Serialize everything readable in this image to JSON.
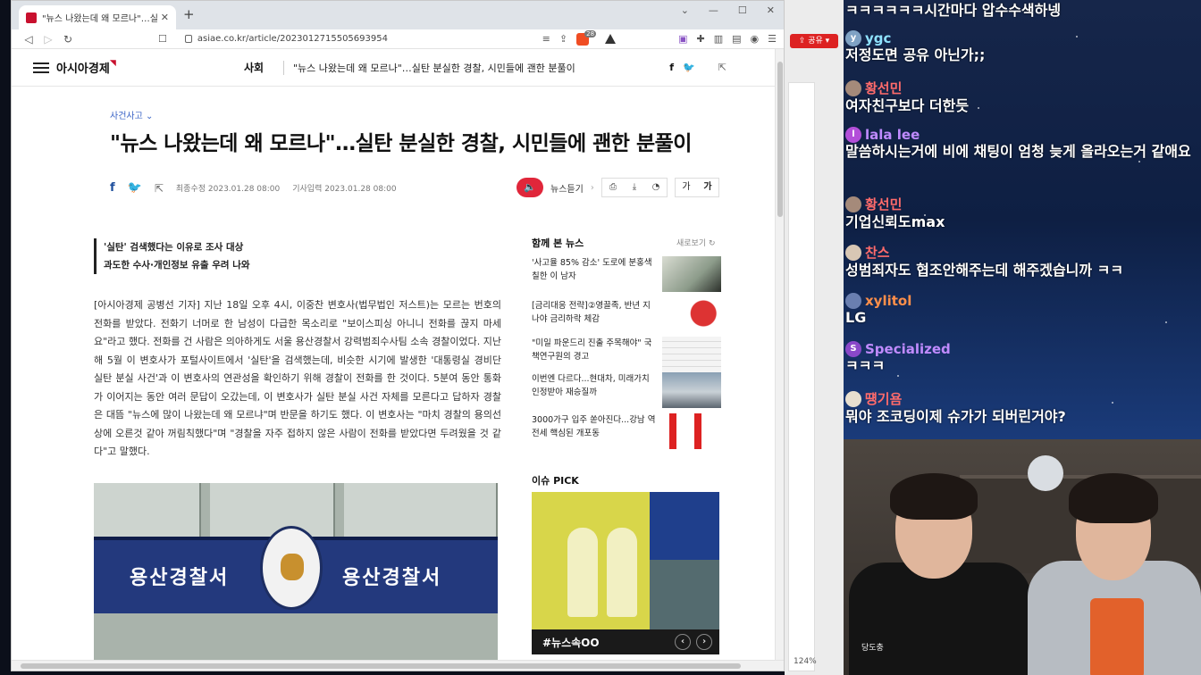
{
  "browser": {
    "tab_title": "\"뉴스 나왔는데 왜 모르나\"…실탄",
    "new_tab_icon": "plus-icon",
    "url": "asiae.co.kr/article/2023012715505693954",
    "brave_count": "28"
  },
  "site": {
    "logo": "아시아경제",
    "section": "사회",
    "header_headline": "\"뉴스 나왔는데 왜 모르나\"…실탄 분실한 경찰, 시민들에 괜한 분풀이"
  },
  "article": {
    "category": "사건사고",
    "title": "\"뉴스 나왔는데 왜 모르나\"…실탄 분실한 경찰, 시민들에 괜한 분풀이",
    "updated_label": "최종수정",
    "updated": "2023.01.28 08:00",
    "published_label": "기사입력",
    "published": "2023.01.28 08:00",
    "listen_label": "뉴스듣기",
    "font_small": "가",
    "font_large": "가",
    "subtitle_1": "'실탄' 검색했다는 이유로 조사 대상",
    "subtitle_2": "과도한 수사·개인정보 유출 우려 나와",
    "body": "[아시아경제 공병선 기자] 지난 18일 오후 4시, 이중찬 변호사(법무법인 저스트)는 모르는 번호의 전화를 받았다. 전화기 너머로 한 남성이 다급한 목소리로 \"보이스피싱 아니니 전화를 끊지 마세요\"라고 했다. 전화를 건 사람은 의아하게도 서울 용산경찰서 강력범죄수사팀 소속 경찰이었다. 지난해 5월 이 변호사가 포털사이트에서 '실탄'을 검색했는데, 비슷한 시기에 발생한 '대통령실 경비단 실탄 분실 사건'과 이 변호사의 연관성을 확인하기 위해 경찰이 전화를 한 것이다. 5분여 동안 통화가 이어지는 동안 여러 문답이 오갔는데, 이 변호사가 실탄 분실 사건 자체를 모른다고 답하자 경찰은 대뜸 \"뉴스에 많이 나왔는데 왜 모르냐\"며 반문을 하기도 했다. 이 변호사는 \"마치 경찰의 용의선상에 오른것 같아 꺼림칙했다\"며 \"경찰을 자주 접하지 않은 사람이 전화를 받았다면 두려웠을 것 같다\"고 말했다.",
    "photo_sign_left": "용산경찰서",
    "photo_sign_right": "용산경찰서"
  },
  "sidebar": {
    "together_title": "함께 본 뉴스",
    "refresh_label": "새로보기",
    "items": [
      {
        "text": "'사고율 85% 감소' 도로에 분홍색 칠한 이 남자"
      },
      {
        "text": "[금리대응 전략]②영끌족, 반년 지나야 금리하락 체감"
      },
      {
        "text": "\"미일 파운드리 진출 주목해야\" 국책연구원의 경고"
      },
      {
        "text": "이번엔 다르다...현대차, 미래가치 인정받아 재승질까"
      },
      {
        "text": "3000가구 입주 쏟아진다...강남 역전세 핵심된 개포동"
      }
    ],
    "issue_title": "이슈 PICK",
    "issue_tag": "#뉴스속OO"
  },
  "side_window": {
    "share_label": "공유"
  },
  "zoom": "124%",
  "chat": [
    {
      "name": "",
      "message": "ㅋㅋㅋㅋㅋㅋ시간마다 압수수색하넹",
      "color": "#ffffff",
      "avatar": ""
    },
    {
      "name": "ygc",
      "message": "저정도면 공유 아닌가;;",
      "color": "#8fe3ff",
      "avatar": "#7fa2c4"
    },
    {
      "name": "황선민",
      "message": "여자친구보다 더한듯",
      "color": "#ff6b6b",
      "avatar": "#a58a7a"
    },
    {
      "name": "lala lee",
      "message": "말씀하시는거에 비에 채팅이 엄청 늦게 올라오는거 같애요",
      "color": "#c08bff",
      "avatar": "#b34fd9"
    },
    {
      "name": "황선민",
      "message": "기업신뢰도max",
      "color": "#ff6b6b",
      "avatar": "#a58a7a"
    },
    {
      "name": "찬스",
      "message": "성범죄자도 협조안해주는데 해주겠습니까 ㅋㅋ",
      "color": "#ff6b6b",
      "avatar": "#d8c7b4"
    },
    {
      "name": "xylitol",
      "message": "LG",
      "color": "#ff8f4a",
      "avatar": "#6a7fb0"
    },
    {
      "name": "Specialized",
      "message": "ㅋㅋㅋ",
      "color": "#c08bff",
      "avatar": "#8a48c9"
    },
    {
      "name": "떙기욤",
      "message": "뭐야 조코딩이제 슈가가 되버린거야?",
      "color": "#ff6b6b",
      "avatar": "#e8dfcf"
    }
  ],
  "cam_label": "당도충"
}
